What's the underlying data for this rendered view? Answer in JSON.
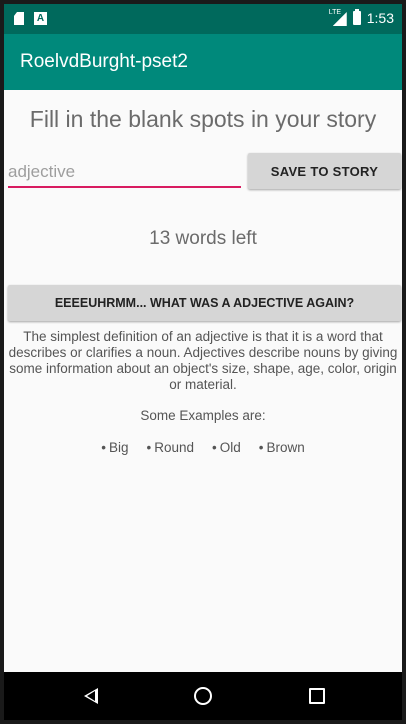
{
  "status_bar": {
    "time": "1:53",
    "network_label": "LTE",
    "icons": [
      "sd-card-icon",
      "a-notification-icon",
      "lte-signal-icon",
      "battery-charging-icon"
    ],
    "a_icon_glyph": "A"
  },
  "app_bar": {
    "title": "RoelvdBurght-pset2",
    "color": "#00897b",
    "status_color": "#00695c"
  },
  "main": {
    "heading": "Fill in the blank spots in your story",
    "input": {
      "placeholder": "adjective",
      "value": "",
      "accent_color": "#d81b60"
    },
    "save_button_label": "SAVE TO STORY",
    "words_left": "13 words left",
    "hint_button_label": "EEEEUHRMM... WHAT WAS A ADJECTIVE AGAIN?",
    "definition": "The simplest definition of an adjective is that it is a word that describes or clarifies a noun. Adjectives describe nouns by giving some information about an object's size, shape, age, color, origin or material.",
    "examples_label": "Some Examples are:",
    "examples": [
      "Big",
      "Round",
      "Old",
      "Brown"
    ],
    "bullet": "•"
  },
  "nav_bar": {
    "icons": [
      "back-icon",
      "home-icon",
      "recents-icon"
    ]
  }
}
